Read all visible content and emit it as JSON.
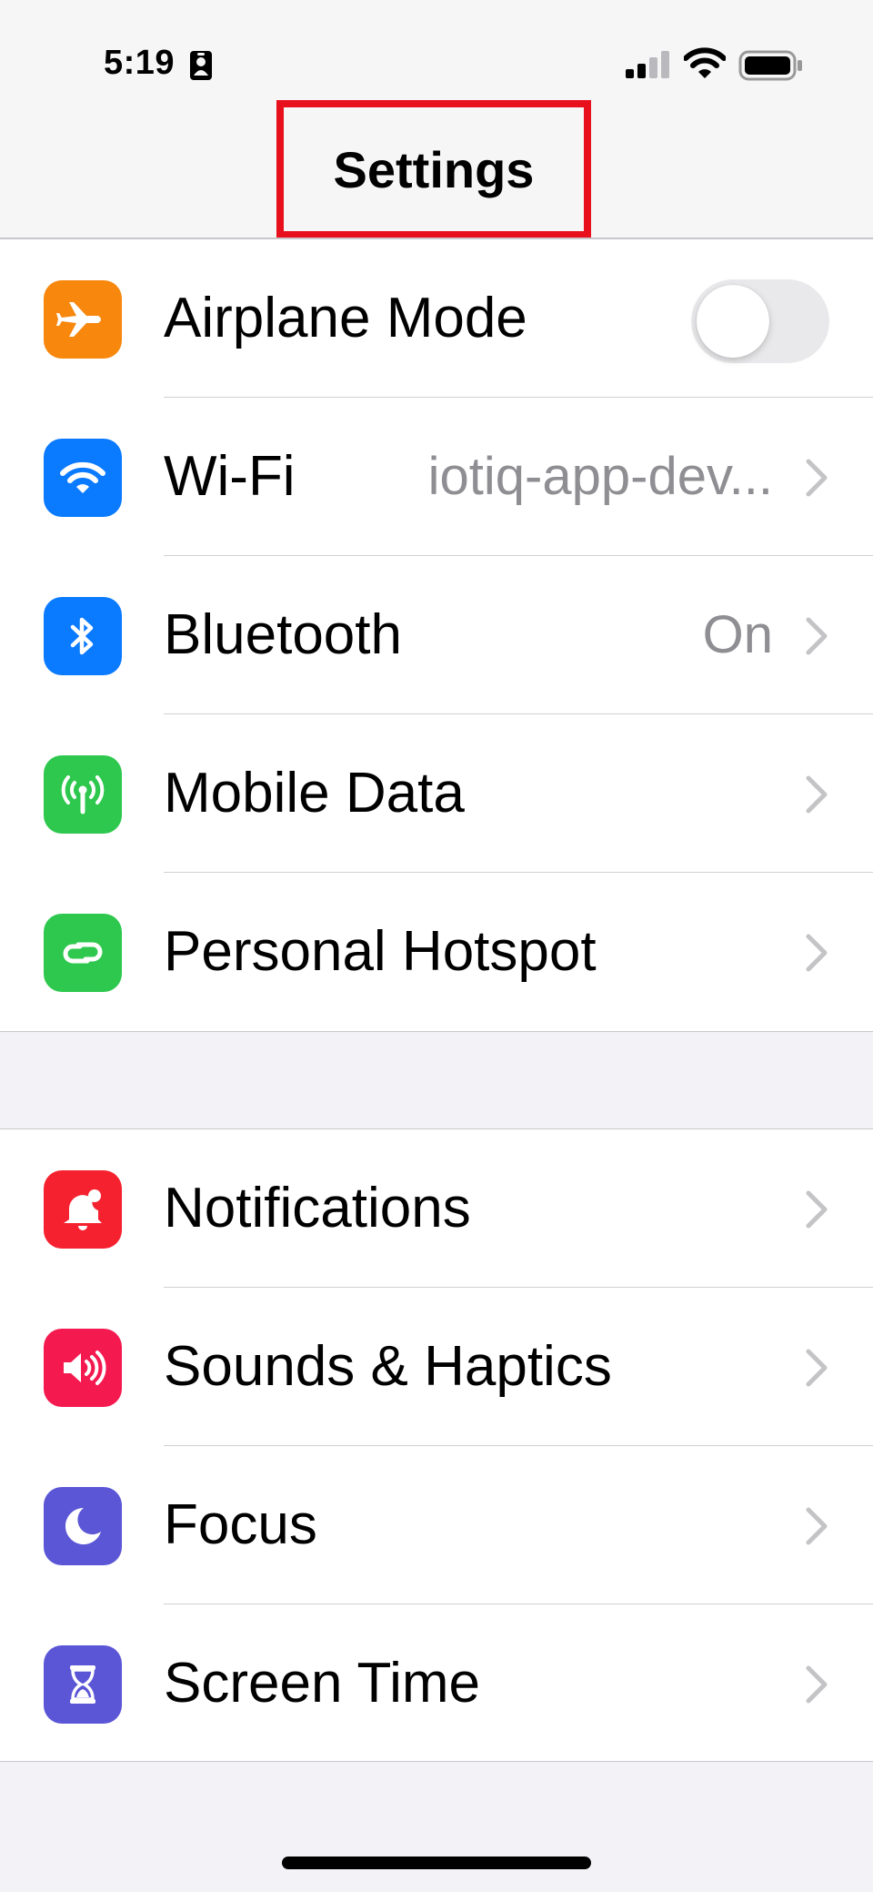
{
  "status_bar": {
    "time": "5:19",
    "icons": [
      "contact-card-icon",
      "cellular-signal-icon",
      "wifi-icon",
      "battery-icon"
    ]
  },
  "nav": {
    "title": "Settings",
    "highlight_color": "#e8101c"
  },
  "groups": [
    {
      "rows": [
        {
          "label": "Airplane Mode",
          "icon": "airplane-icon",
          "icon_color": "#f7870d",
          "control": "toggle",
          "toggle_on": false
        },
        {
          "label": "Wi-Fi",
          "icon": "wifi-icon",
          "icon_color": "#0a7aff",
          "value": "iotiq-app-dev..."
        },
        {
          "label": "Bluetooth",
          "icon": "bluetooth-icon",
          "icon_color": "#0a7aff",
          "value": "On"
        },
        {
          "label": "Mobile Data",
          "icon": "antenna-icon",
          "icon_color": "#2dc84d"
        },
        {
          "label": "Personal Hotspot",
          "icon": "hotspot-link-icon",
          "icon_color": "#2dc84d"
        }
      ]
    },
    {
      "rows": [
        {
          "label": "Notifications",
          "icon": "bell-icon",
          "icon_color": "#f5212f"
        },
        {
          "label": "Sounds & Haptics",
          "icon": "speaker-icon",
          "icon_color": "#f4194f"
        },
        {
          "label": "Focus",
          "icon": "moon-icon",
          "icon_color": "#5b56d6"
        },
        {
          "label": "Screen Time",
          "icon": "hourglass-icon",
          "icon_color": "#5b56d6"
        }
      ]
    }
  ]
}
